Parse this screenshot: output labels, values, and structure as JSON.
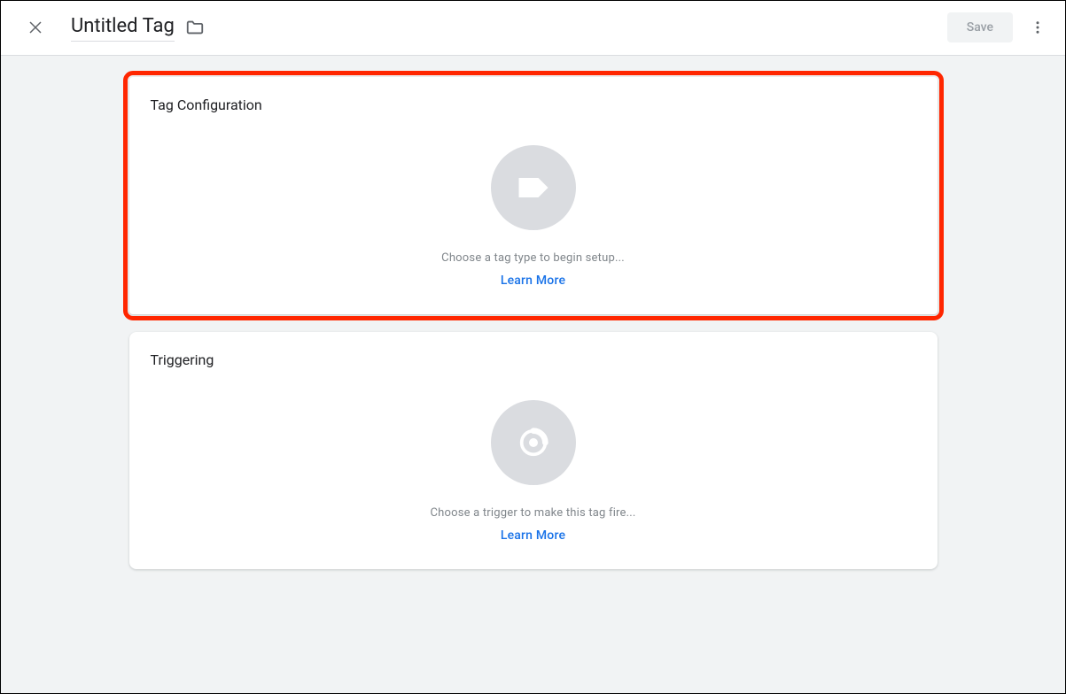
{
  "header": {
    "title": "Untitled Tag",
    "save_label": "Save"
  },
  "cards": {
    "tag_config": {
      "title": "Tag Configuration",
      "prompt": "Choose a tag type to begin setup...",
      "learn_more": "Learn More"
    },
    "triggering": {
      "title": "Triggering",
      "prompt": "Choose a trigger to make this tag fire...",
      "learn_more": "Learn More"
    }
  }
}
